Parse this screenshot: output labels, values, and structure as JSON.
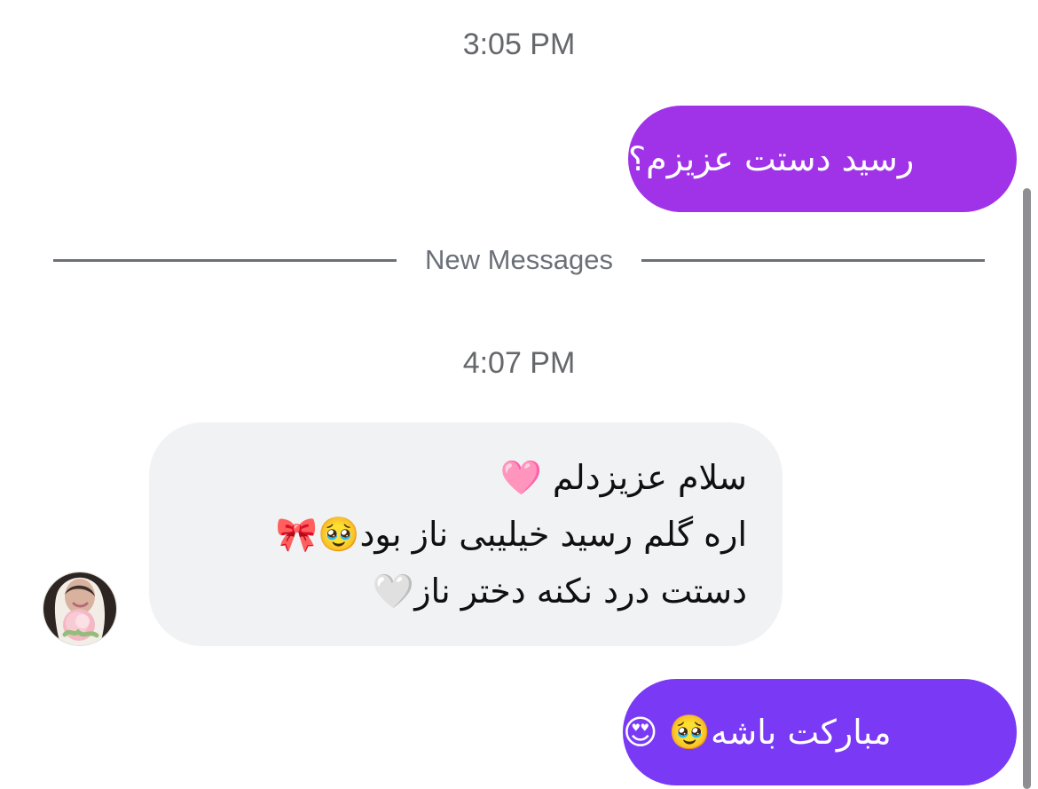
{
  "timestamps": {
    "first": "3:05 PM",
    "second": "4:07 PM"
  },
  "divider": {
    "label": "New Messages"
  },
  "messages": {
    "sent_1": "رسید دستت عزیزم؟",
    "received_lines": [
      "سلام عزیزدلم 🩷",
      "اره گلم رسید خیلیبی ناز بود🥹🎀",
      "دستت درد نکنه دختر ناز🤍"
    ],
    "sent_2": "مبارکت باشه🥹 😍"
  },
  "colors": {
    "sent_bubble_1": "#a033e8",
    "sent_bubble_2": "#7a3af5",
    "received_bubble": "#f1f2f4",
    "timestamp_text": "#65676b",
    "divider": "#6b7078"
  },
  "avatar": {
    "icon": "profile-photo-avatar"
  }
}
